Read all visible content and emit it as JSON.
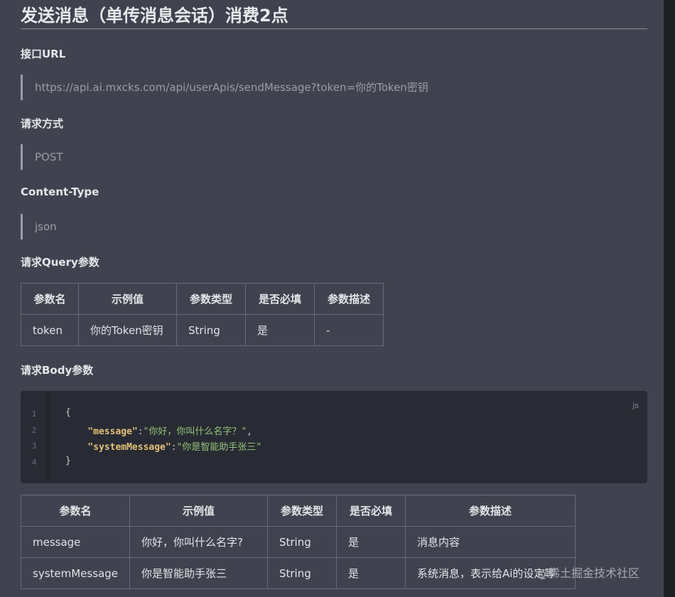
{
  "title": "发送消息（单传消息会话）消费2点",
  "url_section": {
    "label": "接口URL",
    "value": "https://api.ai.mxcks.com/api/userApis/sendMessage?token=你的Token密钥"
  },
  "method_section": {
    "label": "请求方式",
    "value": "POST"
  },
  "content_type_section": {
    "label": "Content-Type",
    "value": "json"
  },
  "query_section": {
    "label": "请求Query参数",
    "headers": [
      "参数名",
      "示例值",
      "参数类型",
      "是否必填",
      "参数描述"
    ],
    "rows": [
      [
        "token",
        "你的Token密钥",
        "String",
        "是",
        "-"
      ]
    ]
  },
  "body_section": {
    "label": "请求Body参数",
    "code_lang": "js",
    "line_numbers": [
      "1",
      "2",
      "3",
      "4"
    ],
    "code": {
      "open": "{",
      "message_key": "\"message\"",
      "message_val": "\"你好，你叫什么名字？\"",
      "system_key": "\"systemMessage\"",
      "system_val": "\"你是智能助手张三\"",
      "close": "}"
    },
    "headers": [
      "参数名",
      "示例值",
      "参数类型",
      "是否必填",
      "参数描述"
    ],
    "rows": [
      [
        "message",
        "你好，你叫什么名字?",
        "String",
        "是",
        "消息内容"
      ],
      [
        "systemMessage",
        "你是智能助手张三",
        "String",
        "是",
        "系统消息，表示给Ai的设定等"
      ]
    ]
  },
  "watermark": "@稀土掘金技术社区"
}
